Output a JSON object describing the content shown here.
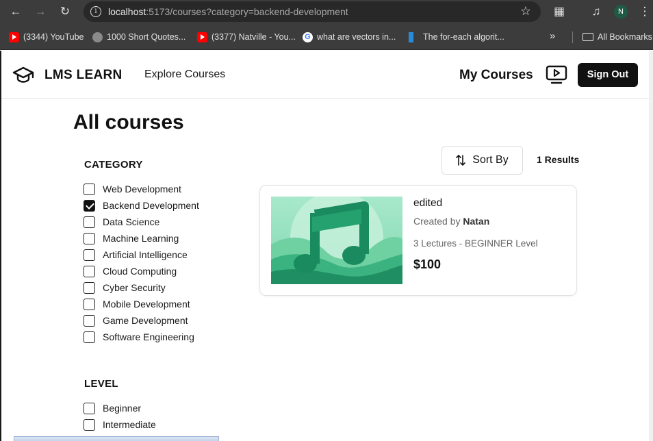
{
  "browser": {
    "url_host": "localhost",
    "url_rest": ":5173/courses?category=backend-development",
    "profile_initial": "N",
    "bookmarks": [
      {
        "label": "(3344) YouTube",
        "icon": "youtube-icon"
      },
      {
        "label": "1000 Short Quotes...",
        "icon": "globe-icon"
      },
      {
        "label": "(3377) Natville - You...",
        "icon": "youtube-icon"
      },
      {
        "label": "what are vectors in...",
        "icon": "google-icon"
      },
      {
        "label": "The for-each algorit...",
        "icon": "site-icon"
      }
    ],
    "all_bookmarks": "All Bookmarks"
  },
  "header": {
    "logo": "LMS LEARN",
    "explore": "Explore Courses",
    "my_courses": "My Courses",
    "sign_out": "Sign Out"
  },
  "page_title": "All courses",
  "filters": {
    "category_title": "CATEGORY",
    "categories": [
      {
        "label": "Web Development",
        "checked": false
      },
      {
        "label": "Backend Development",
        "checked": true
      },
      {
        "label": "Data Science",
        "checked": false
      },
      {
        "label": "Machine Learning",
        "checked": false
      },
      {
        "label": "Artificial Intelligence",
        "checked": false
      },
      {
        "label": "Cloud Computing",
        "checked": false
      },
      {
        "label": "Cyber Security",
        "checked": false
      },
      {
        "label": "Mobile Development",
        "checked": false
      },
      {
        "label": "Game Development",
        "checked": false
      },
      {
        "label": "Software Engineering",
        "checked": false
      }
    ],
    "level_title": "LEVEL",
    "levels": [
      {
        "label": "Beginner",
        "checked": false
      },
      {
        "label": "Intermediate",
        "checked": false
      }
    ]
  },
  "sort": {
    "label": "Sort By"
  },
  "results": "1 Results",
  "course": {
    "title": "edited",
    "created_by_prefix": "Created by",
    "author": "Natan",
    "meta": "3 Lectures - BEGINNER Level",
    "price": "$100"
  },
  "colors": {
    "accent": "#111111",
    "thumb_green": "#1f9e6a"
  }
}
